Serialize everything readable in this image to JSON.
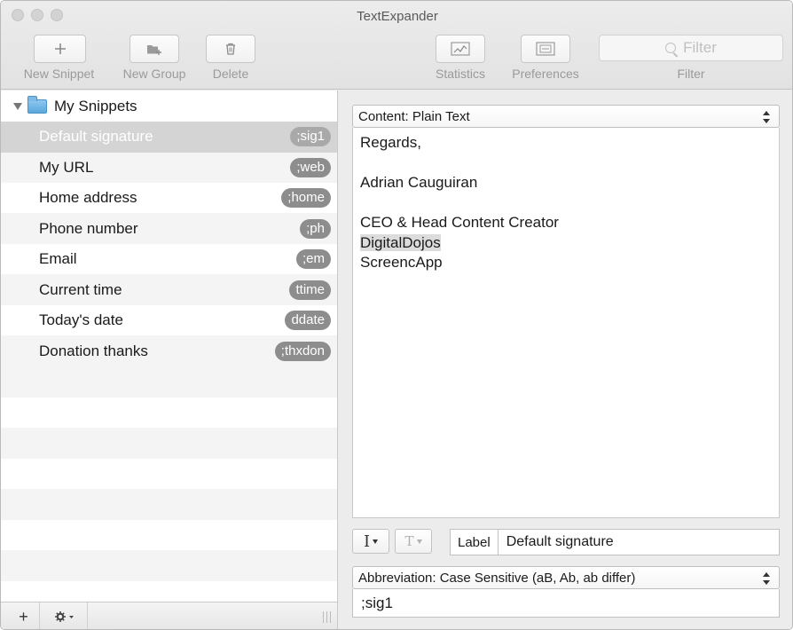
{
  "window": {
    "title": "TextExpander"
  },
  "toolbar": {
    "new_snippet": "New Snippet",
    "new_group": "New Group",
    "delete": "Delete",
    "statistics": "Statistics",
    "preferences": "Preferences",
    "filter_placeholder": "Filter",
    "filter_label": "Filter"
  },
  "sidebar": {
    "group": {
      "name": "My Snippets",
      "icon": "folder-icon"
    },
    "snippets": [
      {
        "label": "Default signature",
        "abbr": ";sig1",
        "selected": true
      },
      {
        "label": "My URL",
        "abbr": ";web"
      },
      {
        "label": "Home address",
        "abbr": ";home"
      },
      {
        "label": "Phone number",
        "abbr": ";ph"
      },
      {
        "label": "Email",
        "abbr": ";em"
      },
      {
        "label": "Current time",
        "abbr": "ttime"
      },
      {
        "label": "Today's date",
        "abbr": "ddate"
      },
      {
        "label": "Donation thanks",
        "abbr": ";thxdon"
      }
    ],
    "footer": {
      "add": "+",
      "gear": "gear-icon"
    }
  },
  "editor": {
    "content_type": "Content: Plain Text",
    "content_lines": [
      "Regards,",
      "",
      "Adrian Cauguiran",
      "",
      "CEO & Head Content Creator",
      "DigitalDojos",
      "ScreencApp"
    ],
    "highlighted_line": "DigitalDojos",
    "label_tag": "Label",
    "label_value": "Default signature",
    "abbreviation_mode": "Abbreviation: Case Sensitive (aB, Ab, ab differ)",
    "abbreviation_value": ";sig1"
  },
  "colors": {
    "selected_row": "#d4d4d4",
    "pill": "#8d8d8d",
    "stripe": "#f4f4f4"
  }
}
